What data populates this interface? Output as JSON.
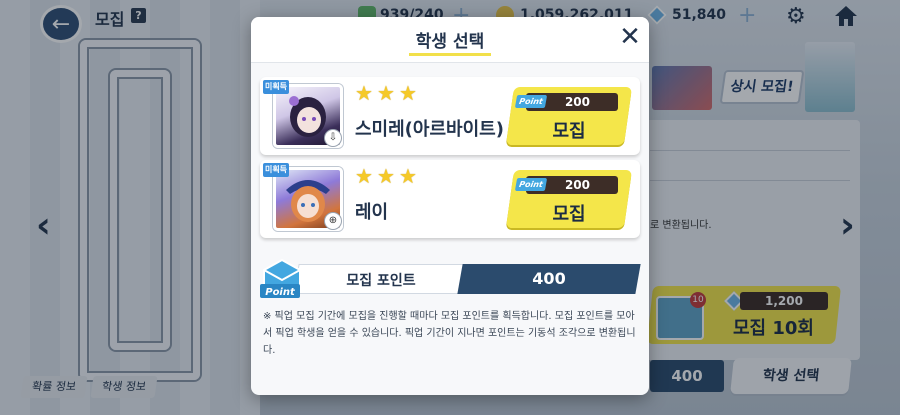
{
  "header": {
    "title": "모집",
    "help_label": "?",
    "ap": "939/240",
    "credits": "1,059,262,011",
    "pyroxene": "51,840"
  },
  "background": {
    "banner_tag": "상시 모집!",
    "desc_fragment": "로 변환됩니다.",
    "ten_pull": {
      "mail_badge": "10",
      "cost": "1,200",
      "label": "모집 10회"
    },
    "bottom_points": "400",
    "select_student_label": "학생 선택",
    "tabs": [
      "확률 정보",
      "학생 정보"
    ]
  },
  "modal": {
    "title": "학생 선택",
    "close_label": "✕",
    "students": [
      {
        "tag": "미획득",
        "stars": 3,
        "name": "스미레(아르바이트)",
        "point_chip": "Point",
        "cost": "200",
        "button_label": "모집",
        "portrait_colors": [
          "#3b2f5a",
          "#a8a0c8"
        ]
      },
      {
        "tag": "미획득",
        "stars": 3,
        "name": "레이",
        "point_chip": "Point",
        "cost": "200",
        "button_label": "모집",
        "portrait_colors": [
          "#2c3f8c",
          "#e0884a"
        ]
      }
    ],
    "points": {
      "icon_label": "Point",
      "label": "모집 포인트",
      "value": "400"
    },
    "notice": "※ 픽업 모집 기간에 모집을 진행할 때마다 모집 포인트를 획득합니다. 모집 포인트를 모아서 픽업 학생을 얻을 수 있습니다. 픽업 기간이 지나면 포인트는 기동석 조각으로 변환됩니다."
  },
  "colors": {
    "accent_yellow": "#f4e64a",
    "navy": "#23344d",
    "point_blue": "#43a7e0",
    "unowned_blue": "#3a8fdc"
  }
}
